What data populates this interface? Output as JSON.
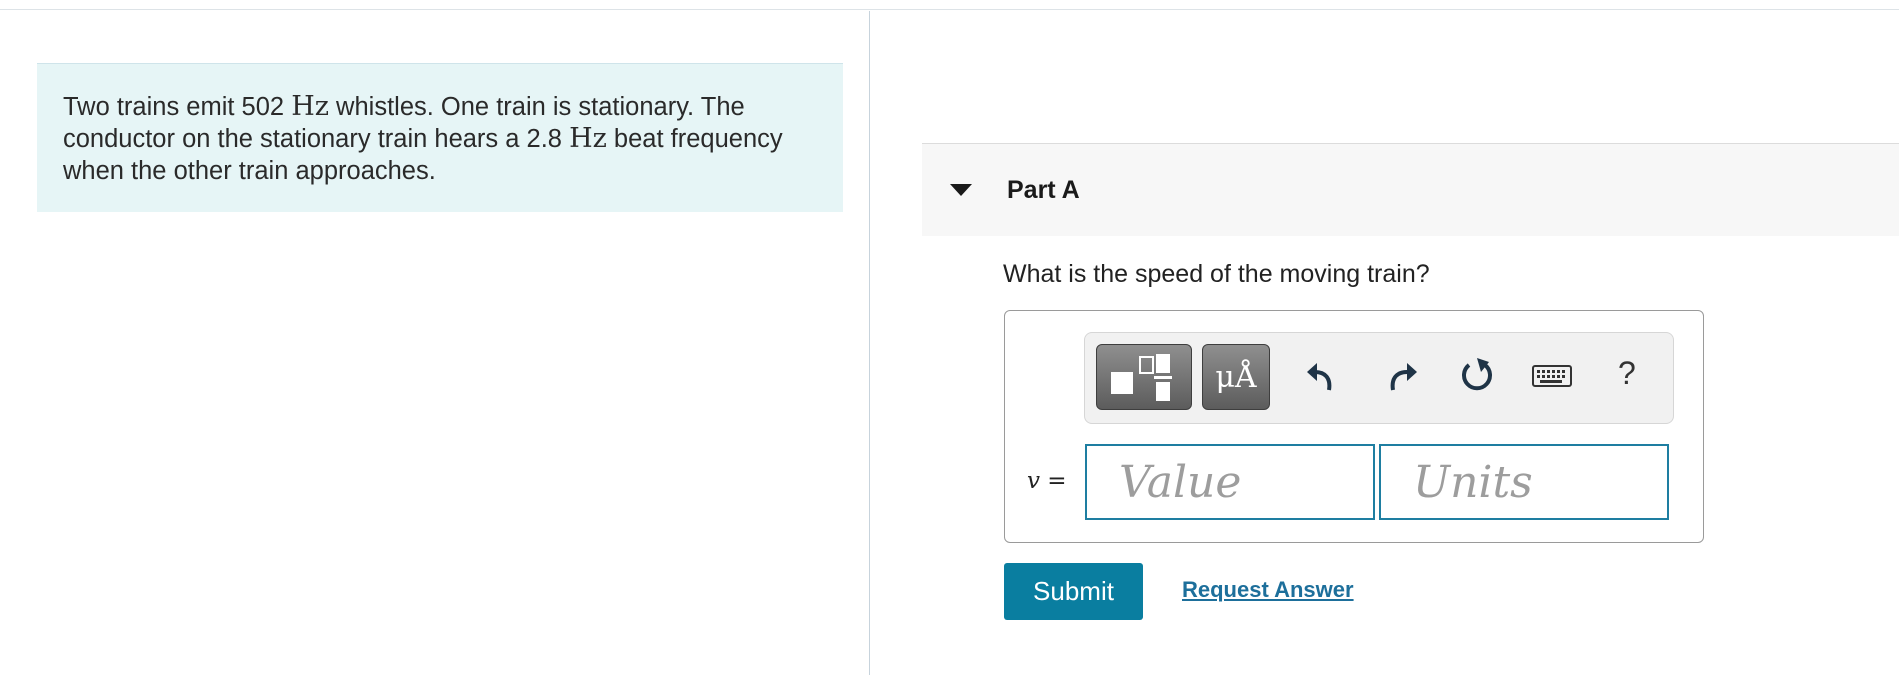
{
  "problem": {
    "text_1": "Two trains emit 502 ",
    "unit_1": "Hz",
    "text_2": " whistles. One train is stationary. The conductor on the stationary train hears a 2.8 ",
    "unit_2": "Hz",
    "text_3": " beat frequency when the other train approaches."
  },
  "part": {
    "title": "Part A",
    "question": "What is the speed of the moving train?"
  },
  "toolbar": {
    "templates_icon": "fraction-template-icon",
    "units_label": "μÅ",
    "undo_icon": "undo-icon",
    "redo_icon": "redo-icon",
    "reset_icon": "reset-icon",
    "keyboard_icon": "keyboard-icon",
    "help_label": "?"
  },
  "answer": {
    "variable": "v",
    "equals": " =",
    "value_placeholder": "Value",
    "value": "",
    "units_placeholder": "Units",
    "units": ""
  },
  "actions": {
    "submit_label": "Submit",
    "request_label": "Request Answer"
  },
  "colors": {
    "accent": "#0a7ea0",
    "problem_bg": "#e6f5f6",
    "link": "#1d6f9b"
  }
}
